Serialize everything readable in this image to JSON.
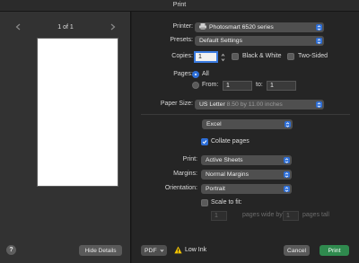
{
  "window": {
    "title": "Print"
  },
  "preview": {
    "page_indicator": "1 of 1"
  },
  "left_footer": {
    "help_label": "?",
    "hide_details_label": "Hide Details"
  },
  "printer": {
    "label": "Printer:",
    "value": "Photosmart 6520 series"
  },
  "presets": {
    "label": "Presets:",
    "value": "Default Settings"
  },
  "copies": {
    "label": "Copies:",
    "value": "1",
    "bw_label": "Black & White",
    "two_sided_label": "Two-Sided",
    "bw_checked": false,
    "two_sided_checked": false
  },
  "pages": {
    "label": "Pages:",
    "all_label": "All",
    "from_label": "From:",
    "from_value": "1",
    "to_label": "to:",
    "to_value": "1",
    "selected": "All"
  },
  "paper_size": {
    "label": "Paper Size:",
    "value": "US Letter",
    "detail": "8.50 by 11.00 inches"
  },
  "section": {
    "value": "Excel"
  },
  "collate": {
    "label": "Collate pages",
    "checked": true
  },
  "print_what": {
    "label": "Print:",
    "value": "Active Sheets"
  },
  "margins": {
    "label": "Margins:",
    "value": "Normal Margins"
  },
  "orientation": {
    "label": "Orientation:",
    "value": "Portrait"
  },
  "scale": {
    "label": "Scale to fit:",
    "checked": false,
    "wide_value": "1",
    "wide_label": "pages wide by",
    "tall_value": "1",
    "tall_label": "pages tall"
  },
  "footer": {
    "pdf_label": "PDF",
    "warning_text": "Low Ink",
    "cancel_label": "Cancel",
    "print_label": "Print"
  },
  "colors": {
    "accent": "#2e6fd8",
    "print_button": "#2f8a4e",
    "warning": "#f2c200"
  },
  "icons": {
    "prev": "chevron-left-icon",
    "next": "chevron-right-icon",
    "printer": "printer-icon",
    "warning": "warning-triangle-icon"
  }
}
